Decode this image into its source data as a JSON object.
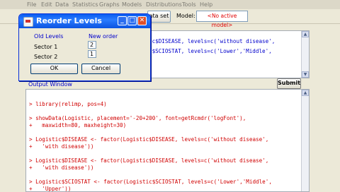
{
  "menu": [
    "File",
    "Edit",
    "Data",
    "Statistics",
    "Graphs",
    "Models",
    "Distributions",
    "Tools",
    "Help"
  ],
  "toolbar": {
    "dataset_button": "ata set",
    "model_label": "Model:",
    "model_value": "<No active model>"
  },
  "script_lines": [
    "ic$DISEASE, levels=c('without disease',",
    "",
    "c$SCIOSTAT, levels=c('Lower','Middle',"
  ],
  "submit_label": "Submit",
  "output_window": {
    "label": "Output Window",
    "lines": [
      "> library(relimp, pos=4)",
      "",
      "> showData(Logistic, placement='-20+200', font=getRcmdr('logFont'),",
      "+   maxwidth=80, maxheight=30)",
      "",
      "> Logistic$DISEASE <- factor(Logistic$DISEASE, levels=c('without disease',",
      "+   'with disease'))",
      "",
      "> Logistic$DISEASE <- factor(Logistic$DISEASE, levels=c('without disease',",
      "+   'with disease'))",
      "",
      "> Logistic$SCIOSTAT <- factor(Logistic$SCIOSTAT, levels=c('Lower','Middle',",
      "+   'Upper'))"
    ]
  },
  "dialog": {
    "title": "Reorder Levels",
    "old_levels_header": "Old Levels",
    "new_order_header": "New order",
    "rows": [
      {
        "label": "Sector 1",
        "value": "2"
      },
      {
        "label": "Sector 2",
        "value": "1"
      }
    ],
    "ok_label": "OK",
    "cancel_label": "Cancel"
  },
  "colors": {
    "title_bar": "#0a5cf0",
    "output_text": "#d00000",
    "script_text": "#0000cc",
    "model_text": "#e00000"
  }
}
